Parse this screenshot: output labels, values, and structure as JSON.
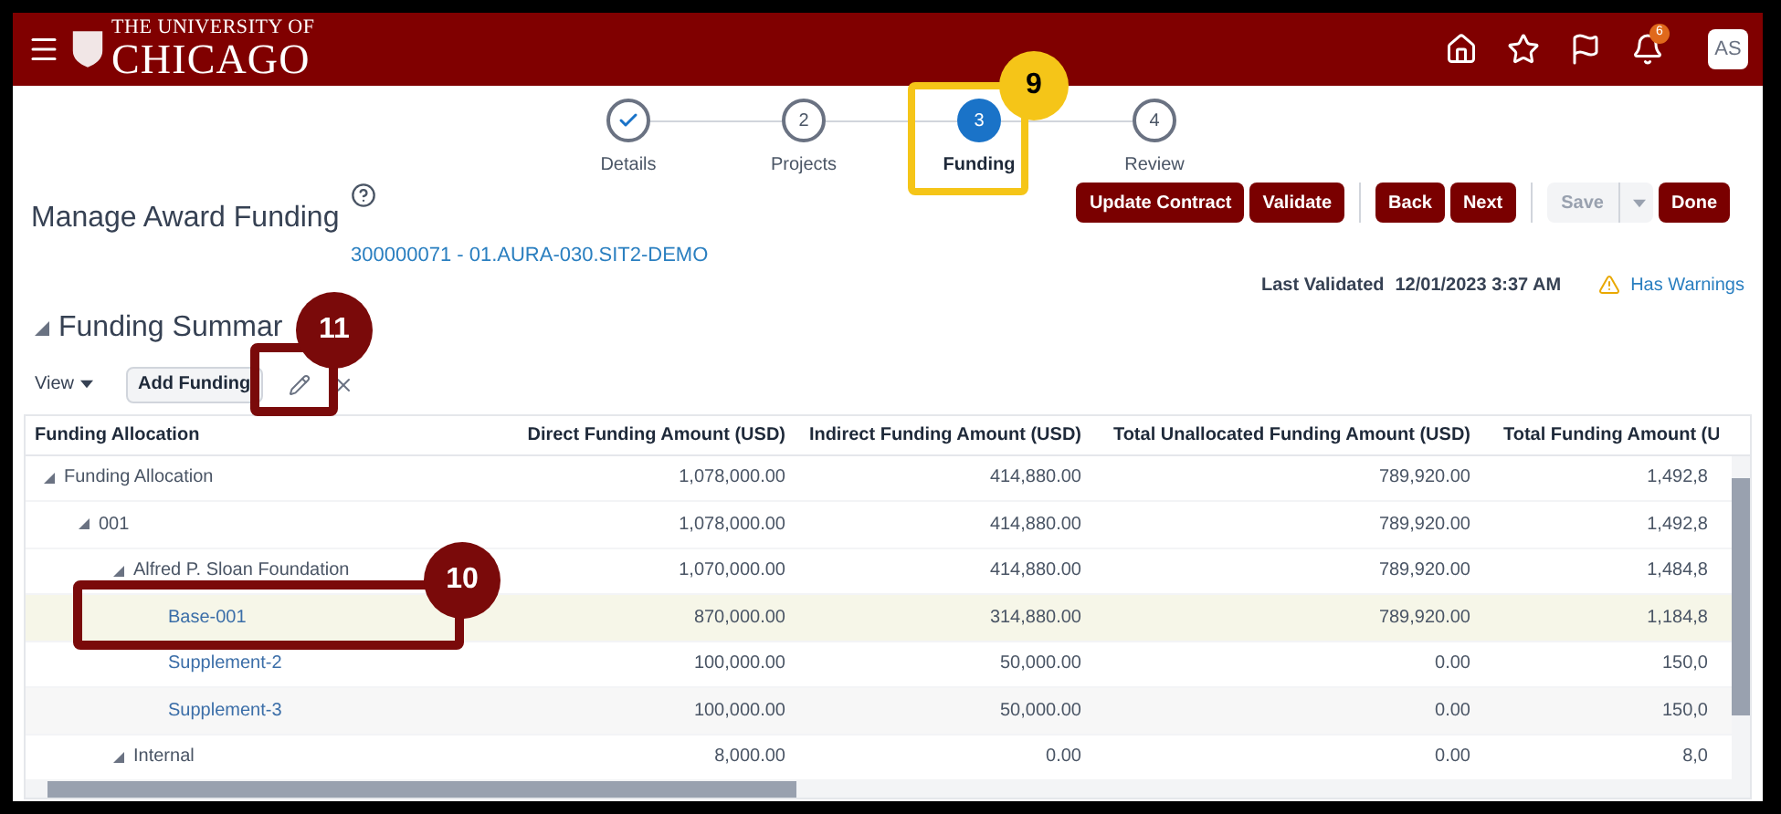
{
  "header": {
    "logo_top": "THE UNIVERSITY OF",
    "logo_bottom": "CHICAGO",
    "notification_count": "6",
    "avatar": "AS"
  },
  "steps": [
    {
      "label": "Details",
      "completed": true,
      "selected": false
    },
    {
      "number": "2",
      "label": "Projects",
      "completed": false,
      "selected": false
    },
    {
      "number": "3",
      "label": "Funding",
      "completed": false,
      "selected": true
    },
    {
      "number": "4",
      "label": "Review",
      "completed": false,
      "selected": false
    }
  ],
  "page_title": "Manage Award Funding",
  "award_link": "300000071 - 01.AURA-030.SIT2-DEMO",
  "actions": [
    {
      "label": "Update Contract",
      "kind": "primary"
    },
    {
      "label": "Validate",
      "kind": "primary"
    },
    {
      "label": "Back",
      "kind": "primary"
    },
    {
      "label": "Next",
      "kind": "primary"
    },
    {
      "label": "Save",
      "kind": "split",
      "disabled": true
    },
    {
      "label": "Done",
      "kind": "primary"
    }
  ],
  "validation": {
    "label": "Last Validated",
    "value": "12/01/2023 3:37 AM",
    "warning": "Has Warnings"
  },
  "section": {
    "title": "Funding Summar",
    "expanded": true
  },
  "toolbar": {
    "view": "View",
    "add": "Add Funding"
  },
  "table": {
    "columns": [
      "Funding Allocation",
      "Direct Funding Amount (USD)",
      "Indirect Funding Amount (USD)",
      "Total Unallocated Funding Amount (USD)",
      "Total Funding Amount (U"
    ],
    "rows": [
      {
        "name": "Funding Allocation",
        "link": false,
        "selected": false,
        "expanded": true,
        "values": [
          "1,078,000.00",
          "414,880.00",
          "789,920.00",
          "1,492,8"
        ],
        "children": [
          {
            "name": "001",
            "link": false,
            "selected": false,
            "expanded": true,
            "values": [
              "1,078,000.00",
              "414,880.00",
              "789,920.00",
              "1,492,8"
            ],
            "children": [
              {
                "name": "Alfred P. Sloan Foundation",
                "link": false,
                "selected": false,
                "expanded": true,
                "values": [
                  "1,070,000.00",
                  "414,880.00",
                  "789,920.00",
                  "1,484,8"
                ],
                "children": [
                  {
                    "name": "Base-001",
                    "link": true,
                    "selected": true,
                    "values": [
                      "870,000.00",
                      "314,880.00",
                      "789,920.00",
                      "1,184,8"
                    ]
                  },
                  {
                    "name": "Supplement-2",
                    "link": true,
                    "selected": false,
                    "values": [
                      "100,000.00",
                      "50,000.00",
                      "0.00",
                      "150,0"
                    ]
                  },
                  {
                    "name": "Supplement-3",
                    "link": true,
                    "selected": false,
                    "values": [
                      "100,000.00",
                      "50,000.00",
                      "0.00",
                      "150,0"
                    ]
                  }
                ]
              },
              {
                "name": "Internal",
                "link": false,
                "selected": false,
                "expanded": true,
                "values": [
                  "8,000.00",
                  "0.00",
                  "0.00",
                  "8,0"
                ]
              }
            ]
          }
        ]
      }
    ]
  },
  "callouts": [
    {
      "number": "9",
      "kind": "yellow"
    },
    {
      "number": "10",
      "kind": "maroon"
    },
    {
      "number": "11",
      "kind": "maroon"
    }
  ]
}
